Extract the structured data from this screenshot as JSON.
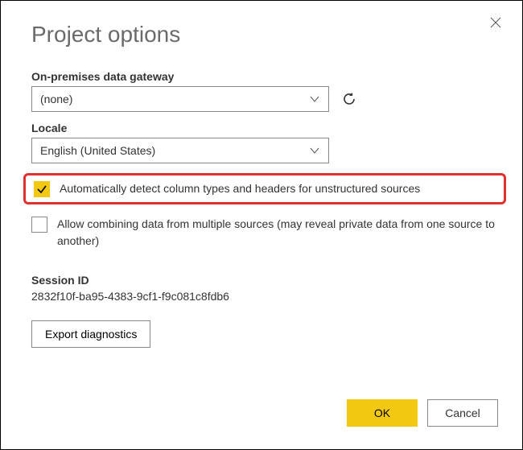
{
  "title": "Project options",
  "gateway": {
    "label": "On-premises data gateway",
    "value": "(none)"
  },
  "locale": {
    "label": "Locale",
    "value": "English (United States)"
  },
  "checkboxes": {
    "autodetect": {
      "label": "Automatically detect column types and headers for unstructured sources",
      "checked": true
    },
    "combine": {
      "label": "Allow combining data from multiple sources (may reveal private data from one source to another)",
      "checked": false
    }
  },
  "session": {
    "label": "Session ID",
    "value": "2832f10f-ba95-4383-9cf1-f9c081c8fdb6"
  },
  "buttons": {
    "export": "Export diagnostics",
    "ok": "OK",
    "cancel": "Cancel"
  }
}
